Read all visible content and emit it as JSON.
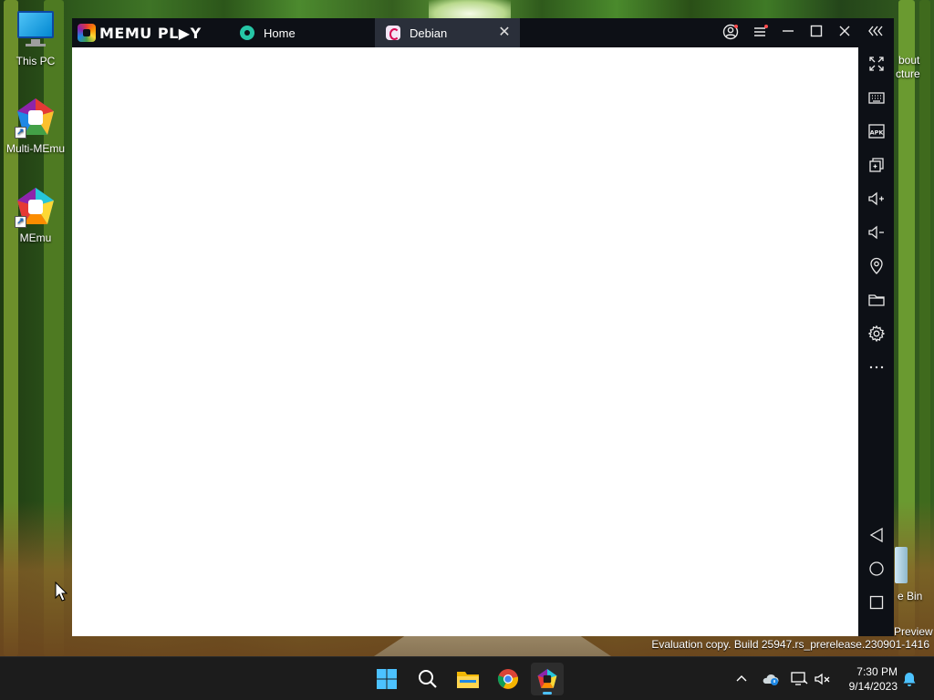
{
  "desktop": {
    "icons": [
      {
        "label": "This PC"
      },
      {
        "label": "Multi-MEmu"
      },
      {
        "label": "MEmu"
      }
    ],
    "partial_right_labels": [
      "bout",
      "cture",
      "e Bin",
      "Preview"
    ],
    "watermark": "Evaluation copy. Build 25947.rs_prerelease.230901-1416"
  },
  "emulator": {
    "brand": "MEMU PL▶Y",
    "tabs": [
      {
        "label": "Home",
        "icon": "memu-home-icon"
      },
      {
        "label": "Debian",
        "icon": "debian-icon",
        "active": true
      }
    ],
    "title_controls": [
      "account-icon",
      "menu-icon",
      "minimize-icon",
      "maximize-icon",
      "close-icon",
      "collapse-sidebar-icon"
    ],
    "sidebar_tools": [
      "fullscreen-icon",
      "keyboard-icon",
      "apk-icon",
      "multi-window-icon",
      "volume-up-icon",
      "volume-down-icon",
      "location-icon",
      "folder-icon",
      "settings-icon",
      "more-icon"
    ],
    "nav_buttons": [
      "back-icon",
      "home-icon",
      "recents-icon"
    ],
    "screen_content": ""
  },
  "taskbar": {
    "apps": [
      "start-icon",
      "search-icon",
      "file-explorer-icon",
      "chrome-icon",
      "memu-icon"
    ],
    "active_app": "memu-icon",
    "tray": [
      "chevron-up-icon",
      "onedrive-icon",
      "display-icon",
      "volume-muted-icon",
      "notification-bell-icon"
    ],
    "time": "7:30 PM",
    "date": "9/14/2023"
  },
  "colors": {
    "titlebar": "#0d1016",
    "active_tab": "#2a2f3a",
    "screen": "#ffffff",
    "taskbar": "#1c1c1c",
    "taskbar_accent": "#4cc2ff"
  }
}
